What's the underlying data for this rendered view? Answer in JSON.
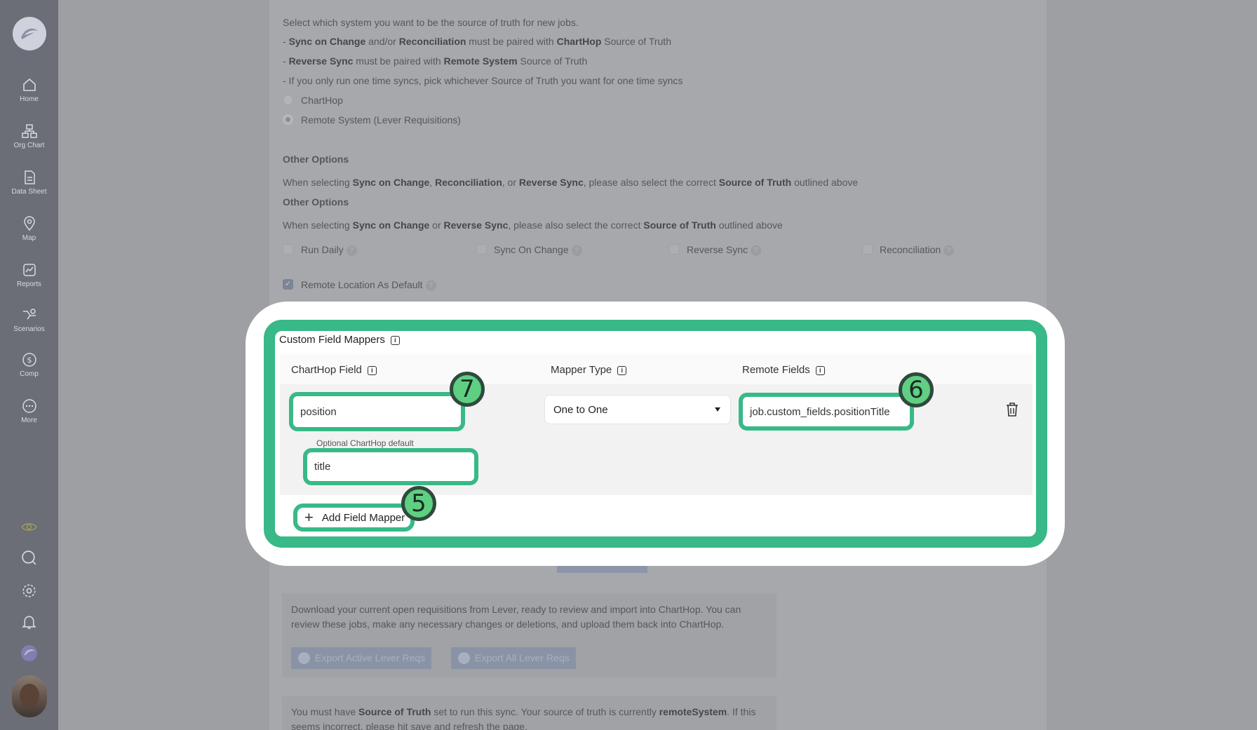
{
  "sidebar": {
    "items": [
      {
        "label": "Home",
        "icon": "home-icon"
      },
      {
        "label": "Org Chart",
        "icon": "org-chart-icon"
      },
      {
        "label": "Data Sheet",
        "icon": "data-sheet-icon"
      },
      {
        "label": "Map",
        "icon": "map-pin-icon"
      },
      {
        "label": "Reports",
        "icon": "reports-icon"
      },
      {
        "label": "Scenarios",
        "icon": "scenarios-icon"
      },
      {
        "label": "Comp",
        "icon": "dollar-icon"
      },
      {
        "label": "More",
        "icon": "more-icon"
      }
    ],
    "utilities": [
      "eye-icon",
      "search-icon",
      "gear-icon",
      "bell-icon",
      "chathop-icon"
    ]
  },
  "source_of_truth": {
    "intro": "Select which system you want to be the source of truth for new jobs.",
    "rule1": {
      "pre": "- ",
      "b1": "Sync on Change",
      "m1": " and/or ",
      "b2": "Reconciliation",
      "m2": " must be paired with ",
      "b3": "ChartHop",
      "post": " Source of Truth"
    },
    "rule2": {
      "pre": "- ",
      "b1": "Reverse Sync",
      "m1": " must be paired with ",
      "b2": "Remote System",
      "post": " Source of Truth"
    },
    "rule3": "- If you only run one time syncs, pick whichever Source of Truth you want for one time syncs",
    "options": [
      "ChartHop",
      "Remote System (Lever Requisitions)"
    ],
    "selected": "Remote System (Lever Requisitions)"
  },
  "other_options": {
    "heading1": "Other Options",
    "line1": {
      "pre": "When selecting ",
      "b1": "Sync on Change",
      "m1": ", ",
      "b2": "Reconciliation",
      "m2": ", or ",
      "b3": "Reverse Sync",
      "m3": ", please also select the correct ",
      "b4": "Source of Truth",
      "post": " outlined above"
    },
    "heading2": "Other Options",
    "line2": {
      "pre": "When selecting ",
      "b1": "Sync on Change",
      "m1": " or ",
      "b2": "Reverse Sync",
      "m2": ", please also select the correct ",
      "b3": "Source of Truth",
      "post": " outlined above"
    },
    "checkboxes": [
      "Run Daily",
      "Sync On Change",
      "Reverse Sync",
      "Reconciliation"
    ],
    "remote_location": "Remote Location As Default"
  },
  "custom_field_mappers": {
    "title": "Custom Field Mappers",
    "columns": [
      "ChartHop Field",
      "Mapper Type",
      "Remote Fields"
    ],
    "row": {
      "charthop_field": "position",
      "optional_label": "Optional ChartHop default",
      "optional_default": "title",
      "mapper_type": "One to One",
      "remote_field": "job.custom_fields.positionTitle"
    },
    "add_label": "Add Field Mapper",
    "badges": {
      "add": "5",
      "remote": "6",
      "charthop": "7"
    }
  },
  "export": {
    "description_line1": "Download your current open requisitions from Lever, ready to review and import into ChartHop. You can",
    "description_line2": "review these jobs, make any necessary changes or deletions, and upload them back into ChartHop.",
    "btn_active": "Export Active Lever Reqs",
    "btn_all": "Export All Lever Reqs"
  },
  "sync_note": {
    "pre": "You must have ",
    "b1": "Source of Truth",
    "m1": " set to run this sync. Your source of truth is currently ",
    "b2": "remoteSystem",
    "post": ". If this",
    "line2": "seems incorrect, please hit save and refresh the page."
  }
}
